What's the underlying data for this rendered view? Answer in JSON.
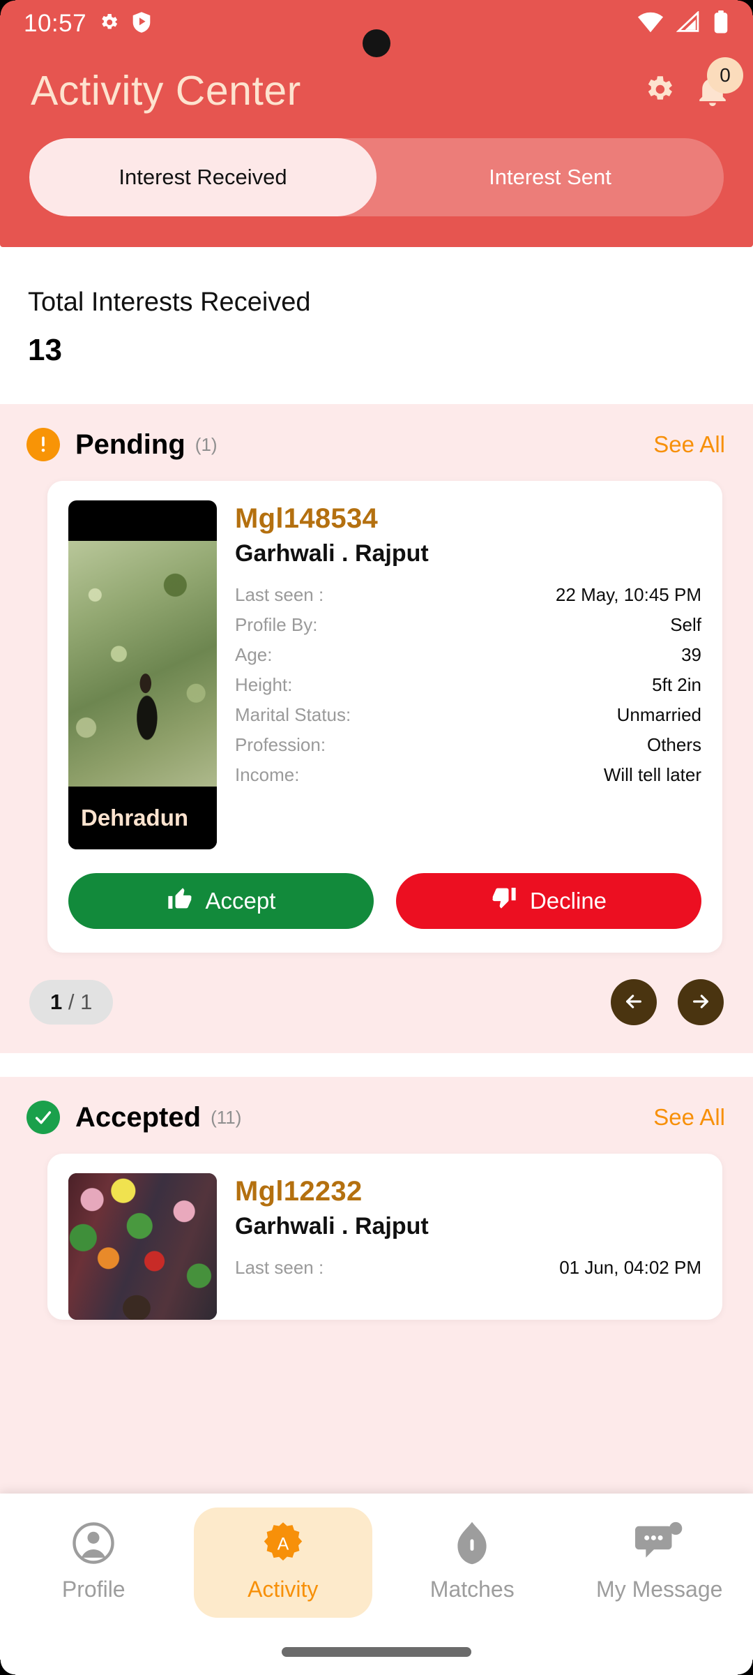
{
  "status_bar": {
    "time": "10:57",
    "icons_left": [
      "gear-icon",
      "shield-play-icon"
    ],
    "icons_right": [
      "wifi-icon",
      "cellular-signal-icon",
      "battery-icon"
    ]
  },
  "header": {
    "title": "Activity Center",
    "settings_icon": "gear-icon",
    "notifications_icon": "bell-icon",
    "notification_count": "0",
    "background_color": "#e65550",
    "title_color": "#fde3cf",
    "tabs": [
      {
        "label": "Interest Received",
        "active": true
      },
      {
        "label": "Interest Sent",
        "active": false
      }
    ]
  },
  "summary": {
    "label": "Total Interests Received",
    "value": "13"
  },
  "sections": [
    {
      "id": "pending",
      "icon": "exclamation-circle-icon",
      "icon_color": "#f89406",
      "title": "Pending",
      "count": "(1)",
      "see_all": "See All",
      "see_all_color": "#f79009",
      "card": {
        "profile_id": "Mgl148534",
        "community": "Garhwali . Rajput",
        "city": "Dehradun",
        "details": [
          {
            "key": "Last seen :",
            "value": "22 May, 10:45 PM"
          },
          {
            "key": "Profile By:",
            "value": "Self"
          },
          {
            "key": "Age:",
            "value": "39"
          },
          {
            "key": "Height:",
            "value": "5ft 2in"
          },
          {
            "key": "Marital Status:",
            "value": "Unmarried"
          },
          {
            "key": "Profession:",
            "value": "Others"
          },
          {
            "key": "Income:",
            "value": "Will tell later"
          }
        ],
        "accept_label": "Accept",
        "accept_icon": "thumbs-up-icon",
        "accept_color": "#128a3b",
        "decline_label": "Decline",
        "decline_icon": "thumbs-down-icon",
        "decline_color": "#ec0f21"
      },
      "pager": {
        "current": "1",
        "separator": "/",
        "total": "1",
        "prev_icon": "arrow-left-icon",
        "next_icon": "arrow-right-icon"
      }
    },
    {
      "id": "accepted",
      "icon": "check-circle-icon",
      "icon_color": "#1aa04b",
      "title": "Accepted",
      "count": "(11)",
      "see_all": "See All",
      "card": {
        "profile_id": "Mgl12232",
        "community": "Garhwali . Rajput",
        "details": [
          {
            "key": "Last seen :",
            "value": "01 Jun, 04:02 PM"
          }
        ]
      }
    }
  ],
  "bottom_nav": [
    {
      "label": "Profile",
      "icon": "person-circle-icon",
      "active": false
    },
    {
      "label": "Activity",
      "icon": "activity-badge-a-icon",
      "active": true
    },
    {
      "label": "Matches",
      "icon": "shield-icon",
      "active": false
    },
    {
      "label": "My Message",
      "icon": "chat-bubble-icon",
      "active": false
    }
  ]
}
